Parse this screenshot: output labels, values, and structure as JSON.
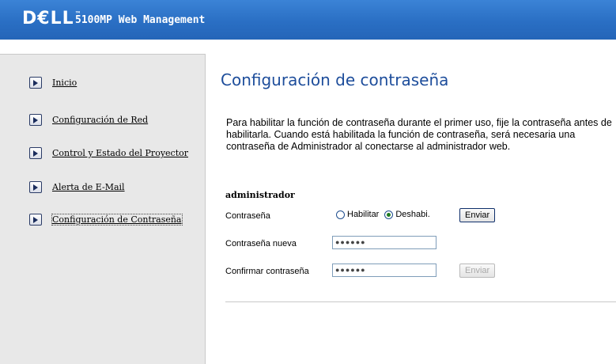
{
  "header": {
    "logo": "D€LL",
    "trademark": "™",
    "product": "5100MP Web Management"
  },
  "sidebar": {
    "items": [
      {
        "label": "Inicio"
      },
      {
        "label": "Configuración de Red"
      },
      {
        "label": "Control y Estado del Proyector"
      },
      {
        "label": "Alerta de E-Mail"
      },
      {
        "label": "Configuración de Contraseña"
      }
    ]
  },
  "main": {
    "title": "Configuración de contraseña",
    "description": "Para habilitar la función de contraseña durante el primer uso, fije la contraseña antes de habilitarla. Cuando está habilitada la función de contraseña, será necesaria una contraseña de Administrador al conectarse al administrador web.",
    "section": "administrador",
    "password_label": "Contraseña",
    "radio_enable": "Habilitar",
    "radio_disable": "Deshabi.",
    "selected_radio": "Deshabi.",
    "submit_label": "Enviar",
    "new_password_label": "Contraseña nueva",
    "new_password_value": "●●●●●●",
    "confirm_password_label": "Confirmar contraseña",
    "confirm_password_value": "●●●●●●",
    "submit2_label": "Enviar"
  }
}
